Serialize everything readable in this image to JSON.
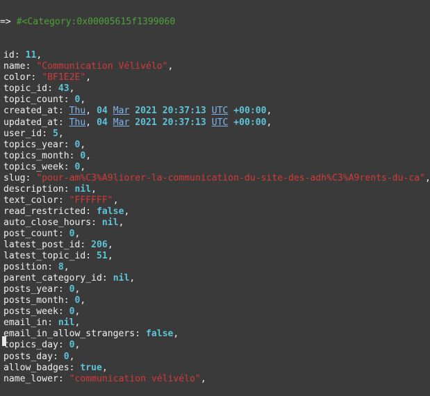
{
  "terminal": {
    "prompt": "=> ",
    "object_header": "#<Category:0x00005615f1399060",
    "fields": [
      {
        "key": "id",
        "type": "num",
        "value": "11"
      },
      {
        "key": "name",
        "type": "str",
        "value": "\"Communication Vélivélo\""
      },
      {
        "key": "color",
        "type": "str",
        "value": "\"BF1E2E\""
      },
      {
        "key": "topic_id",
        "type": "num",
        "value": "43"
      },
      {
        "key": "topic_count",
        "type": "num",
        "value": "0"
      },
      {
        "key": "created_at",
        "type": "date",
        "day": "Thu",
        "date": "04",
        "month": "Mar",
        "year": "2021",
        "time": "20:37:13",
        "tz": "UTC",
        "offset": "+00:00"
      },
      {
        "key": "updated_at",
        "type": "date",
        "day": "Thu",
        "date": "04",
        "month": "Mar",
        "year": "2021",
        "time": "20:37:13",
        "tz": "UTC",
        "offset": "+00:00"
      },
      {
        "key": "user_id",
        "type": "num",
        "value": "5"
      },
      {
        "key": "topics_year",
        "type": "num",
        "value": "0"
      },
      {
        "key": "topics_month",
        "type": "num",
        "value": "0"
      },
      {
        "key": "topics_week",
        "type": "num",
        "value": "0"
      },
      {
        "key": "slug",
        "type": "str",
        "value": "\"pour-am%C3%A9liorer-la-communication-du-site-des-adh%C3%A9rents-du-ca\""
      },
      {
        "key": "description",
        "type": "kw",
        "value": "nil"
      },
      {
        "key": "text_color",
        "type": "str",
        "value": "\"FFFFFF\""
      },
      {
        "key": "read_restricted",
        "type": "kw",
        "value": "false"
      },
      {
        "key": "auto_close_hours",
        "type": "kw",
        "value": "nil"
      },
      {
        "key": "post_count",
        "type": "num",
        "value": "0"
      },
      {
        "key": "latest_post_id",
        "type": "num",
        "value": "206"
      },
      {
        "key": "latest_topic_id",
        "type": "num",
        "value": "51"
      },
      {
        "key": "position",
        "type": "num",
        "value": "8"
      },
      {
        "key": "parent_category_id",
        "type": "kw",
        "value": "nil"
      },
      {
        "key": "posts_year",
        "type": "num",
        "value": "0"
      },
      {
        "key": "posts_month",
        "type": "num",
        "value": "0"
      },
      {
        "key": "posts_week",
        "type": "num",
        "value": "0"
      },
      {
        "key": "email_in",
        "type": "kw",
        "value": "nil"
      },
      {
        "key": "email_in_allow_strangers",
        "type": "kw",
        "value": "false"
      },
      {
        "key": "topics_day",
        "type": "num",
        "value": "0"
      },
      {
        "key": "posts_day",
        "type": "num",
        "value": "0"
      },
      {
        "key": "allow_badges",
        "type": "kw",
        "value": "true"
      },
      {
        "key": "name_lower",
        "type": "str",
        "value": "\"communication vélivélo\""
      }
    ]
  },
  "colors": {
    "background": "#3a3a3a",
    "text": "#f0f0f0",
    "inspect": "#4ea23a",
    "number": "#5ec4d8",
    "string": "#d23a3a",
    "keyword": "#5ec4d8",
    "date": "#7eb4ea"
  }
}
